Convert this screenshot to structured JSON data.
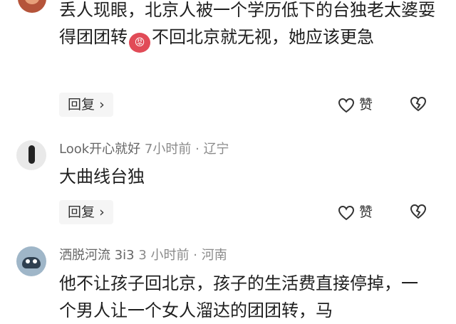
{
  "comments": [
    {
      "user": "",
      "text_before_emoji": "丢人现眼，北京人被一个学历低下的台独老太婆耍得团团转",
      "emoji": "😡",
      "text_after_emoji": "不回北京就无视，她应该更急",
      "reply_label": "回复",
      "like_label": "赞"
    },
    {
      "user": "Look开心就好",
      "time": "7小时前",
      "location": "辽宁",
      "text": "大曲线台独",
      "reply_label": "回复",
      "like_label": "赞"
    },
    {
      "user": "洒脱河流 3i3",
      "time": "3 小时前",
      "location": "河南",
      "text": "他不让孩子回北京，孩子的生活费直接停掉，一个男人让一个女人溜达的团团转，马"
    }
  ],
  "icons": {
    "reply_chevron": "chevron-right-icon",
    "like": "heart-outline-icon",
    "dislike": "broken-heart-icon"
  },
  "colors": {
    "text": "#1f1f1f",
    "meta": "#8a8a8a",
    "reply_bg": "#f5f5f5"
  }
}
